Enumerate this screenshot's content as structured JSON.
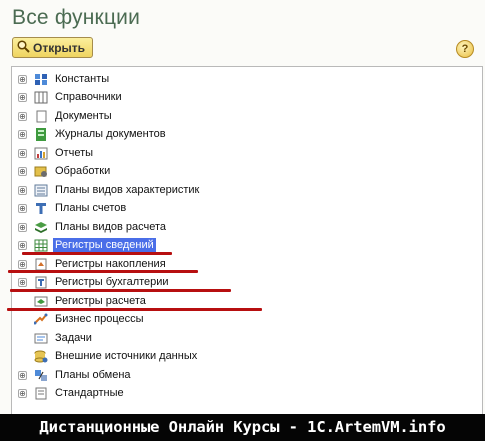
{
  "window": {
    "title": "Все функции"
  },
  "toolbar": {
    "open_label": "Открыть",
    "help_label": "?"
  },
  "tree": {
    "items": [
      {
        "label": "Константы",
        "icon": "constants-icon",
        "expand": "⊕",
        "selected": false
      },
      {
        "label": "Справочники",
        "icon": "catalogs-icon",
        "expand": "⊕",
        "selected": false
      },
      {
        "label": "Документы",
        "icon": "documents-icon",
        "expand": "⊕",
        "selected": false
      },
      {
        "label": "Журналы документов",
        "icon": "document-journals-icon",
        "expand": "⊕",
        "selected": false
      },
      {
        "label": "Отчеты",
        "icon": "reports-icon",
        "expand": "⊕",
        "selected": false
      },
      {
        "label": "Обработки",
        "icon": "processing-icon",
        "expand": "⊕",
        "selected": false
      },
      {
        "label": "Планы видов характеристик",
        "icon": "characteristic-plans-icon",
        "expand": "⊕",
        "selected": false
      },
      {
        "label": "Планы счетов",
        "icon": "chart-of-accounts-icon",
        "expand": "⊕",
        "selected": false
      },
      {
        "label": "Планы видов расчета",
        "icon": "calculation-plans-icon",
        "expand": "⊕",
        "selected": false
      },
      {
        "label": "Регистры сведений",
        "icon": "information-registers-icon",
        "expand": "⊕",
        "selected": true
      },
      {
        "label": "Регистры накопления",
        "icon": "accumulation-registers-icon",
        "expand": "⊕",
        "selected": false
      },
      {
        "label": "Регистры бухгалтерии",
        "icon": "accounting-registers-icon",
        "expand": "⊕",
        "selected": false
      },
      {
        "label": "Регистры расчета",
        "icon": "calculation-registers-icon",
        "expand": "",
        "selected": false
      },
      {
        "label": "Бизнес процессы",
        "icon": "business-processes-icon",
        "expand": "",
        "selected": false
      },
      {
        "label": "Задачи",
        "icon": "tasks-icon",
        "expand": "",
        "selected": false
      },
      {
        "label": "Внешние источники данных",
        "icon": "external-sources-icon",
        "expand": "",
        "selected": false
      },
      {
        "label": "Планы обмена",
        "icon": "exchange-plans-icon",
        "expand": "⊕",
        "selected": false
      },
      {
        "label": "Стандартные",
        "icon": "standard-icon",
        "expand": "⊕",
        "selected": false
      }
    ]
  },
  "colors": {
    "title": "#4b6b52",
    "selection": "#4a6ee8",
    "annotation": "#b70f10"
  },
  "footer": {
    "text": "Дистанционные Онлайн Курсы - 1C.ArtemVM.info"
  }
}
